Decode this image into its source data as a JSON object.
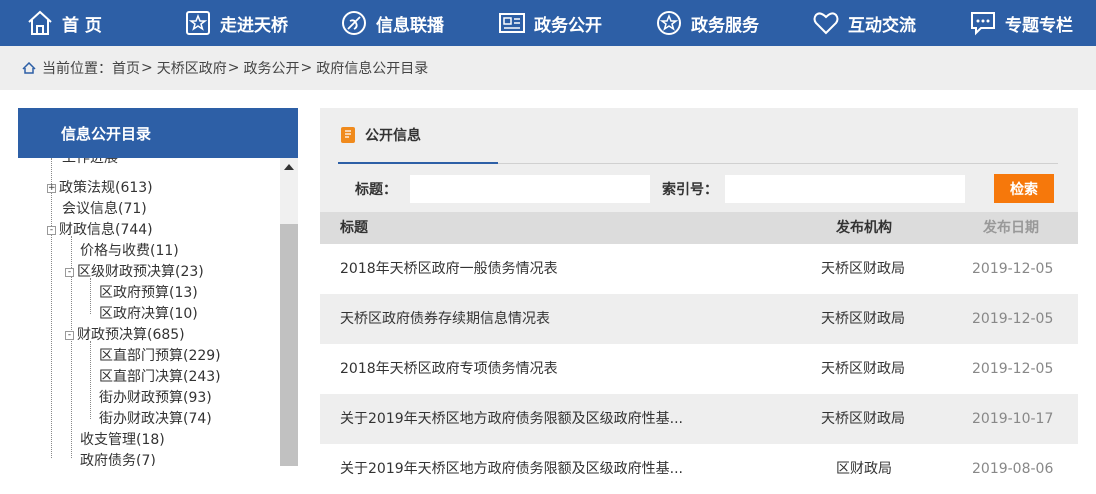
{
  "nav": {
    "items": [
      {
        "label": "首 页",
        "icon": "home-icon"
      },
      {
        "label": "走进天桥",
        "icon": "star-icon"
      },
      {
        "label": "信息联播",
        "icon": "broadcast-icon"
      },
      {
        "label": "政务公开",
        "icon": "newspaper-icon"
      },
      {
        "label": "政务服务",
        "icon": "service-star-icon"
      },
      {
        "label": "互动交流",
        "icon": "heart-icon"
      },
      {
        "label": "专题专栏",
        "icon": "chat-icon"
      }
    ]
  },
  "breadcrumb": {
    "prefix": "当前位置：",
    "items": [
      "首页",
      "天桥区政府",
      "政务公开",
      "政府信息公开目录"
    ],
    "separator": ">"
  },
  "sidebar": {
    "title": "信息公开目录",
    "tree": [
      {
        "label": "工作进展",
        "toggle": ""
      },
      {
        "label": "政策法规(613)",
        "toggle": "+"
      },
      {
        "label": "会议信息(71)",
        "toggle": ""
      },
      {
        "label": "财政信息(744)",
        "toggle": "-"
      },
      {
        "label": "价格与收费(11)",
        "toggle": ""
      },
      {
        "label": "区级财政预决算(23)",
        "toggle": "-"
      },
      {
        "label": "区政府预算(13)",
        "toggle": ""
      },
      {
        "label": "区政府决算(10)",
        "toggle": ""
      },
      {
        "label": "财政预决算(685)",
        "toggle": "-"
      },
      {
        "label": "区直部门预算(229)",
        "toggle": ""
      },
      {
        "label": "区直部门决算(243)",
        "toggle": ""
      },
      {
        "label": "街办财政预算(93)",
        "toggle": ""
      },
      {
        "label": "街办财政决算(74)",
        "toggle": ""
      },
      {
        "label": "收支管理(18)",
        "toggle": ""
      },
      {
        "label": "政府债务(7)",
        "toggle": ""
      }
    ]
  },
  "panel": {
    "tab_label": "公开信息",
    "search": {
      "title_label": "标题：",
      "index_label": "索引号：",
      "title_value": "",
      "index_value": "",
      "button_label": "检索"
    },
    "table": {
      "headers": [
        "标题",
        "发布机构",
        "发布日期"
      ],
      "rows": [
        {
          "title": "2018年天桥区政府一般债务情况表",
          "org": "天桥区财政局",
          "date": "2019-12-05"
        },
        {
          "title": "天桥区政府债券存续期信息情况表",
          "org": "天桥区财政局",
          "date": "2019-12-05"
        },
        {
          "title": "2018年天桥区政府专项债务情况表",
          "org": "天桥区财政局",
          "date": "2019-12-05"
        },
        {
          "title": "关于2019年天桥区地方政府债务限额及区级政府性基...",
          "org": "天桥区财政局",
          "date": "2019-10-17"
        },
        {
          "title": "关于2019年天桥区地方政府债务限额及区级政府性基...",
          "org": "区财政局",
          "date": "2019-08-06"
        }
      ]
    }
  },
  "colors": {
    "nav_bg": "#2d5fa6",
    "accent_orange": "#f6780b"
  }
}
